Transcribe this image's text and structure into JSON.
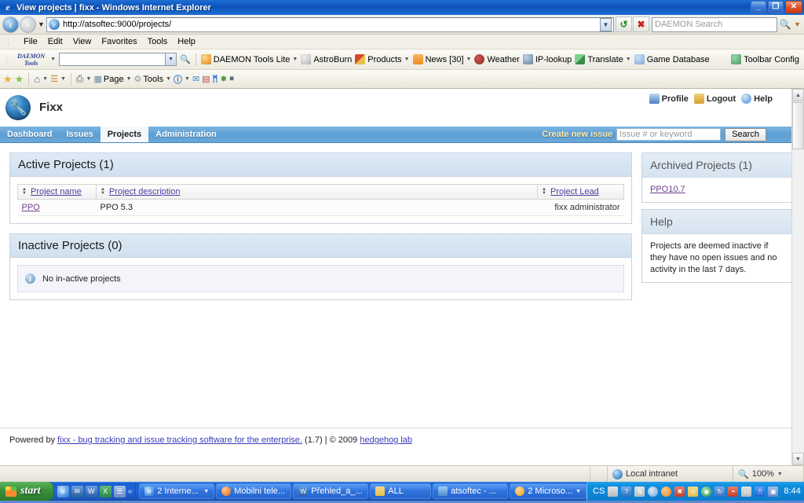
{
  "window": {
    "title": "View projects | fixx - Windows Internet Explorer",
    "minimize_label": "_",
    "maximize_label": "❐",
    "close_label": "✕"
  },
  "address_bar": {
    "url": "http://atsoftec:9000/projects/",
    "back_icon": "back-arrow-icon",
    "forward_icon": "forward-arrow-icon",
    "refresh_icon": "refresh-icon",
    "stop_icon": "stop-icon",
    "search_placeholder": "DAEMON Search",
    "search_value": ""
  },
  "menu_bar": {
    "items": [
      "File",
      "Edit",
      "View",
      "Favorites",
      "Tools",
      "Help"
    ]
  },
  "daemon_toolbar": {
    "logo_line1": "DAEMON",
    "logo_line2": "Tools",
    "input_value": "",
    "items": [
      {
        "label": "DAEMON Tools Lite",
        "color": "#e8a33d",
        "caret": true
      },
      {
        "label": "AstroBurn",
        "color": "#c8c8c8",
        "caret": false
      },
      {
        "label": "Products",
        "color": "#d14a2a",
        "caret": true
      },
      {
        "label": "News [30]",
        "color": "#f08a20",
        "caret": true
      },
      {
        "label": "Weather",
        "color": "#8a2a2a",
        "caret": false
      },
      {
        "label": "IP-lookup",
        "color": "#6a7f9a",
        "caret": false
      },
      {
        "label": "Translate",
        "color": "#3a8a4a",
        "caret": true
      },
      {
        "label": "Game Database",
        "color": "#7fa8d8",
        "caret": false
      }
    ],
    "config_label": "Toolbar Config"
  },
  "command_bar": {
    "items": [
      {
        "name": "favorites-star-icon",
        "glyph": "★",
        "color": "#e8b43a",
        "label": ""
      },
      {
        "name": "add-favorite-icon",
        "glyph": "★",
        "color": "#7fc24f",
        "label": ""
      },
      {
        "name": "home-icon",
        "glyph": "⌂",
        "color": "#3a6fb0",
        "label": "",
        "caret": true
      },
      {
        "name": "feeds-icon",
        "glyph": "◰",
        "color": "#c8843a",
        "label": "",
        "caret": true
      },
      {
        "name": "print-icon",
        "glyph": "⎙",
        "color": "#555555",
        "label": "",
        "caret": true
      },
      {
        "name": "page-menu",
        "glyph": "❐",
        "color": "#6a8aa8",
        "label": "Page",
        "caret": true
      },
      {
        "name": "tools-menu",
        "glyph": "⚙",
        "color": "#8a9aa8",
        "label": "Tools",
        "caret": true
      },
      {
        "name": "help-icon",
        "glyph": "?",
        "color": "#2a6fbf",
        "label": "",
        "caret": true
      },
      {
        "name": "messenger-icon",
        "glyph": "✉",
        "color": "#3a8ad0",
        "label": ""
      },
      {
        "name": "notes-icon",
        "glyph": "☰",
        "color": "#b04a4a",
        "label": ""
      },
      {
        "name": "bluetooth-icon",
        "glyph": "ᛗ",
        "color": "#1a5fd0",
        "label": ""
      },
      {
        "name": "addon-icon",
        "glyph": "✸",
        "color": "#4a9a3a",
        "label": ""
      },
      {
        "name": "skype-icon",
        "glyph": "S",
        "color": "#5a6a7a",
        "label": ""
      }
    ]
  },
  "app": {
    "name": "Fixx",
    "logo_icon": "wrench-icon",
    "header_links": [
      {
        "label": "Profile",
        "icon": "profile-icon",
        "color": "#4a7fbf"
      },
      {
        "label": "Logout",
        "icon": "logout-icon",
        "color": "#d8a030"
      },
      {
        "label": "Help",
        "icon": "help-icon",
        "color": "#4a8fd0"
      }
    ],
    "nav_tabs": [
      {
        "label": "Dashboard",
        "active": false
      },
      {
        "label": "Issues",
        "active": false
      },
      {
        "label": "Projects",
        "active": true
      },
      {
        "label": "Administration",
        "active": false
      }
    ],
    "create_issue_label": "Create new issue",
    "search_placeholder": "Issue # or keyword",
    "search_value": "",
    "search_button": "Search"
  },
  "active_projects": {
    "heading": "Active Projects (1)",
    "columns": [
      "Project name",
      "Project description",
      "Project Lead"
    ],
    "rows": [
      {
        "name": "PPO",
        "description": "PPO 5.3",
        "lead": "fixx administrator"
      }
    ]
  },
  "inactive_projects": {
    "heading": "Inactive Projects (0)",
    "empty_message": "No in-active projects",
    "info_icon": "info-icon"
  },
  "sidebar": {
    "archived": {
      "heading": "Archived Projects (1)",
      "items": [
        "PPO10.7"
      ]
    },
    "help": {
      "heading": "Help",
      "text": "Projects are deemed inactive if they have no open issues and no activity in the last 7 days."
    }
  },
  "footer": {
    "powered_by": "Powered by",
    "link_text": "fixx -  bug tracking and issue tracking software for the enterprise.",
    "version": "(1.7)",
    "separator": "|",
    "copyright": "© 2009",
    "company": "hedgehog lab"
  },
  "status_bar": {
    "zone": "Local intranet",
    "zoom": "100%",
    "zone_icon": "globe-icon",
    "zoom_icon": "magnifier-icon"
  },
  "taskbar": {
    "start_label": "start",
    "quick_launch": [
      {
        "name": "ie-icon",
        "glyph": "e",
        "color": "#1f6fd4"
      },
      {
        "name": "outlook-icon",
        "glyph": "✉",
        "color": "#2a5f9e"
      },
      {
        "name": "word-icon",
        "glyph": "W",
        "color": "#2a5fa8"
      },
      {
        "name": "excel-icon",
        "glyph": "X",
        "color": "#2a8a4a"
      },
      {
        "name": "notepad-icon",
        "glyph": "☰",
        "color": "#6a8ac8"
      }
    ],
    "overflow_glyph": "»",
    "buttons": [
      {
        "label": "2 Interne...",
        "icon_color": "#1f6fd4",
        "glyph": "e",
        "caret": true
      },
      {
        "label": "Mobilni tele...",
        "icon_color": "#e86a20",
        "glyph": "●",
        "caret": false
      },
      {
        "label": "Přehled_a_...",
        "icon_color": "#2a5fa8",
        "glyph": "W",
        "caret": false
      },
      {
        "label": "ALL",
        "icon_color": "#e8c04a",
        "glyph": "■",
        "caret": false
      },
      {
        "label": "atsoftec - ...",
        "icon_color": "#4a8ad0",
        "glyph": "▲",
        "caret": false
      },
      {
        "label": "2 Microso...",
        "icon_color": "#e8a020",
        "glyph": "●",
        "caret": true
      }
    ],
    "tray_lang": "CS",
    "tray_icons": [
      {
        "name": "keyboard-icon",
        "glyph": "⌨",
        "color": "#c8ccd0"
      },
      {
        "name": "help-tray-icon",
        "glyph": "?",
        "color": "#2a6fbf"
      },
      {
        "name": "sync-icon",
        "glyph": "⇅",
        "color": "#b8bcc0"
      },
      {
        "name": "moon-icon",
        "glyph": "☾",
        "color": "#7fa8d8"
      },
      {
        "name": "firefox-tray-icon",
        "glyph": "●",
        "color": "#e88a20"
      },
      {
        "name": "antivirus-icon",
        "glyph": "✖",
        "color": "#c83a2a"
      },
      {
        "name": "user-icon",
        "glyph": "☺",
        "color": "#e8c04a"
      },
      {
        "name": "media-icon",
        "glyph": "◉",
        "color": "#3a9a4a"
      },
      {
        "name": "update-icon",
        "glyph": "↻",
        "color": "#3a6fc0"
      },
      {
        "name": "network-icon",
        "glyph": "◔",
        "color": "#c83a2a"
      },
      {
        "name": "monitor-icon",
        "glyph": "▭",
        "color": "#b8bcc0"
      },
      {
        "name": "bluetooth-tray-icon",
        "glyph": "ᛗ",
        "color": "#1a5fd0"
      },
      {
        "name": "screen-icon",
        "glyph": "▣",
        "color": "#6a8ac8"
      }
    ],
    "clock": "8:44"
  }
}
